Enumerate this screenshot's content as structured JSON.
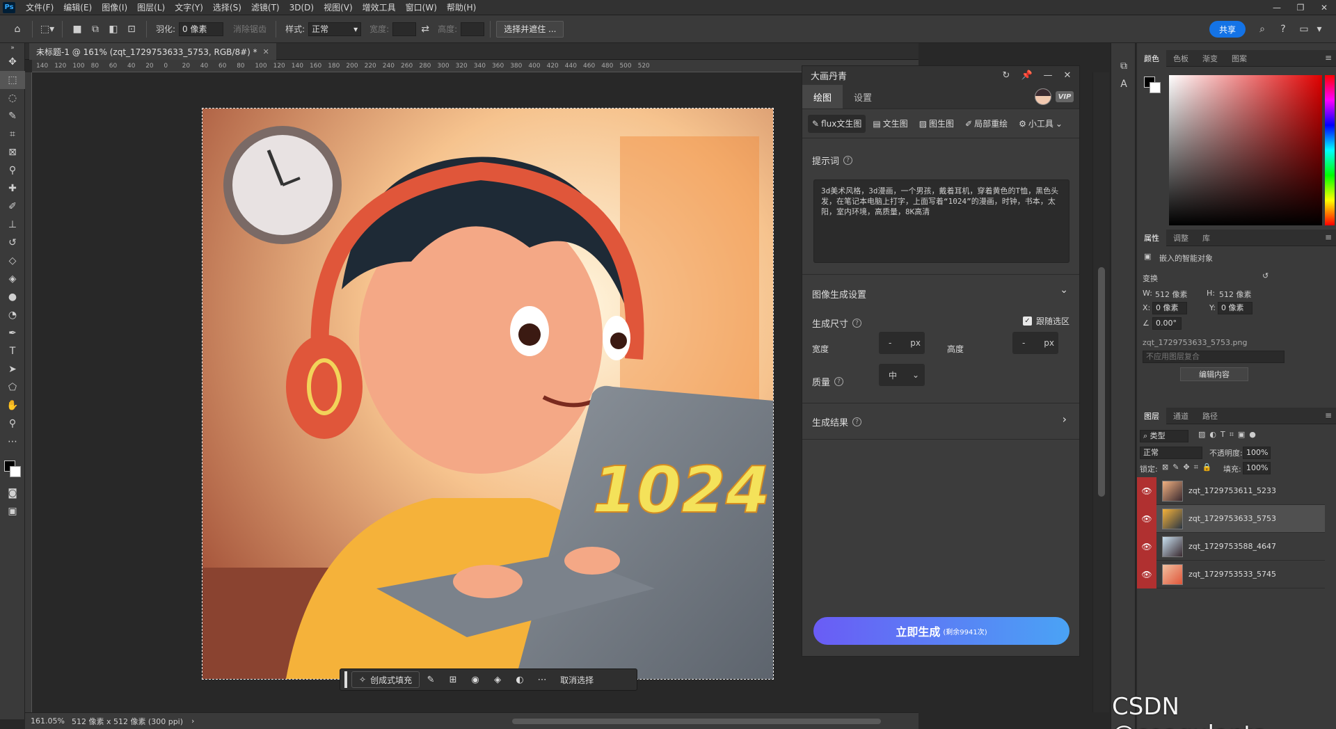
{
  "menubar": {
    "logo": "Ps",
    "items": [
      "文件(F)",
      "编辑(E)",
      "图像(I)",
      "图层(L)",
      "文字(Y)",
      "选择(S)",
      "滤镜(T)",
      "3D(D)",
      "视图(V)",
      "增效工具",
      "窗口(W)",
      "帮助(H)"
    ]
  },
  "options": {
    "feather_label": "羽化:",
    "feather_value": "0 像素",
    "antialias_label": "消除锯齿",
    "style_label": "样式:",
    "style_value": "正常",
    "width_label": "宽度:",
    "height_label": "高度:",
    "select_mask_label": "选择并遮住 ...",
    "share_label": "共享"
  },
  "document": {
    "tab_title": "未标题-1 @ 161% (zqt_1729753633_5753, RGB/8#) *",
    "ruler_ticks": [
      "140",
      "120",
      "100",
      "80",
      "60",
      "40",
      "20",
      "0",
      "20",
      "40",
      "60",
      "80",
      "100",
      "120",
      "140",
      "160",
      "180",
      "200",
      "220",
      "240",
      "260",
      "280",
      "300",
      "320",
      "340",
      "360",
      "380",
      "400",
      "420",
      "440",
      "460",
      "480",
      "500",
      "520"
    ],
    "artwork_text": "1024"
  },
  "context_bar": {
    "generative_fill_label": "创成式填充",
    "deselect_label": "取消选择"
  },
  "status": {
    "zoom": "161.05%",
    "doc_info": "512 像素 x 512 像素 (300 ppi)"
  },
  "plugin": {
    "title": "大画丹青",
    "tabs": [
      "绘图",
      "设置"
    ],
    "vip_label": "VIP",
    "modes": [
      "flux文生图",
      "文生图",
      "图生图",
      "局部重绘",
      "小工具"
    ],
    "prompt_label": "提示词",
    "prompt_text": "3d美术风格，3d漫画，一个男孩，戴着耳机，穿着黄色的T恤，黑色头发，在笔记本电脑上打字，上面写着“1024”的漫画，时钟，书本，太阳，室内环境，高质量，8K高清",
    "image_settings_label": "图像生成设置",
    "size_label": "生成尺寸",
    "follow_selection_label": "跟随选区",
    "width_label": "宽度",
    "width_value": "-",
    "height_label": "高度",
    "height_value": "-",
    "unit": "px",
    "quality_label": "质量",
    "quality_value": "中",
    "result_label": "生成结果",
    "generate_label": "立即生成",
    "generate_sub": "(剩余9941次)"
  },
  "color_panel": {
    "tabs": [
      "颜色",
      "色板",
      "渐变",
      "图案"
    ]
  },
  "properties_panel": {
    "tabs": [
      "属性",
      "调整",
      "库"
    ],
    "object_type": "嵌入的智能对象",
    "transform_label": "变换",
    "w_label": "W:",
    "w_value": "512 像素",
    "h_label": "H:",
    "h_value": "512 像素",
    "x_label": "X:",
    "x_value": "0 像素",
    "y_label": "Y:",
    "y_value": "0 像素",
    "angle_value": "0.00°",
    "filename": "zqt_1729753633_5753.png",
    "comp_placeholder": "不应用图层复合",
    "edit_contents_label": "编辑内容"
  },
  "layers_panel": {
    "tabs": [
      "图层",
      "通道",
      "路径"
    ],
    "filter_label": "类型",
    "blend_mode": "正常",
    "opacity_label": "不透明度:",
    "opacity_value": "100%",
    "lock_label": "锁定:",
    "fill_label": "填充:",
    "fill_value": "100%",
    "layers": [
      {
        "name": "zqt_1729753611_5233",
        "selected": false
      },
      {
        "name": "zqt_1729753633_5753",
        "selected": true
      },
      {
        "name": "zqt_1729753588_4647",
        "selected": false
      },
      {
        "name": "zqt_1729753533_5745",
        "selected": false
      }
    ]
  },
  "watermark": "CSDN @coagulants",
  "colors": {
    "accent": "#1473e6",
    "layer_eye": "#b03030",
    "generate_start": "#6a5cf5",
    "generate_end": "#4aa3f5"
  }
}
